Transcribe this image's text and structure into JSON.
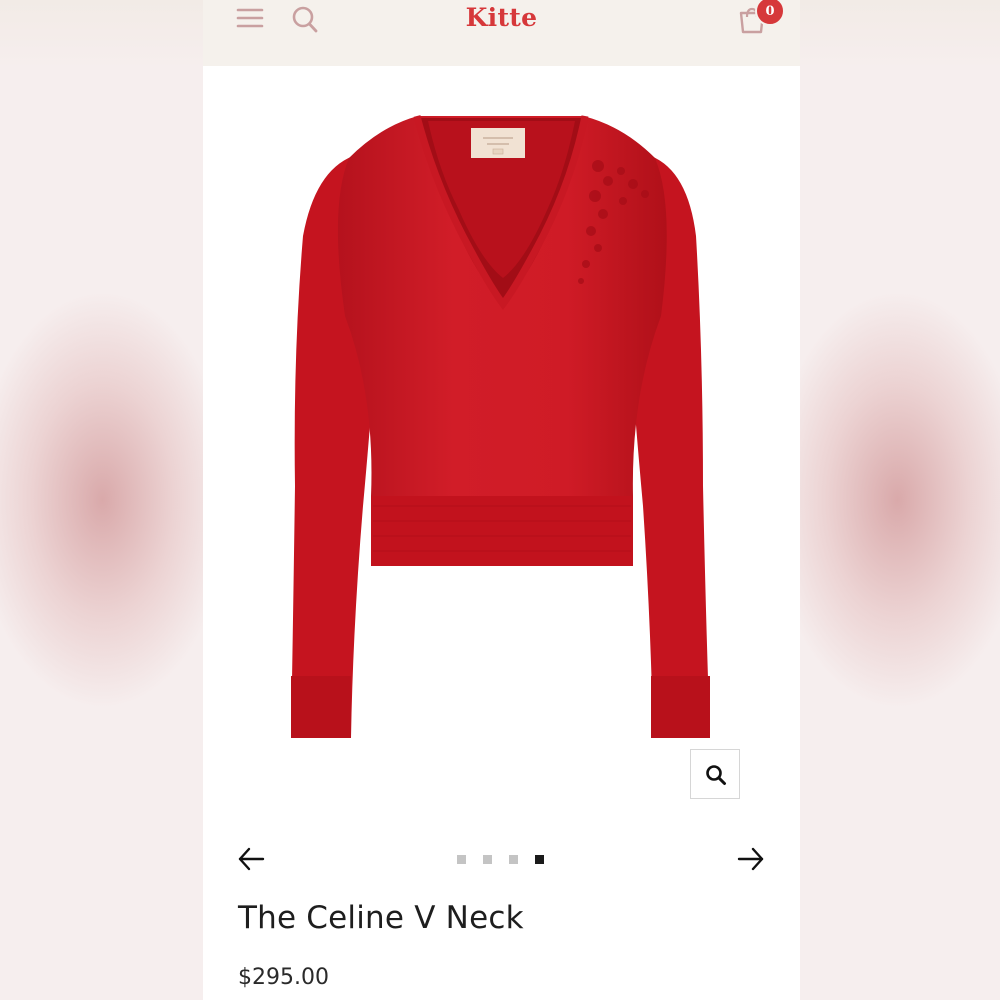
{
  "header": {
    "logo": "Kitte",
    "cart_count": "0",
    "icons": [
      "menu-icon",
      "search-icon",
      "cart-icon"
    ]
  },
  "product": {
    "title": "The Celine V Neck",
    "price": "$295.00",
    "image_color": "#cc1a25"
  },
  "gallery": {
    "slide_count": 4,
    "active_slide": 4,
    "prev_icon": "arrow-left-icon",
    "next_icon": "arrow-right-icon",
    "zoom_icon": "search-icon"
  },
  "colors": {
    "brand": "#d6383a",
    "header_bg": "#f5f1ec"
  }
}
